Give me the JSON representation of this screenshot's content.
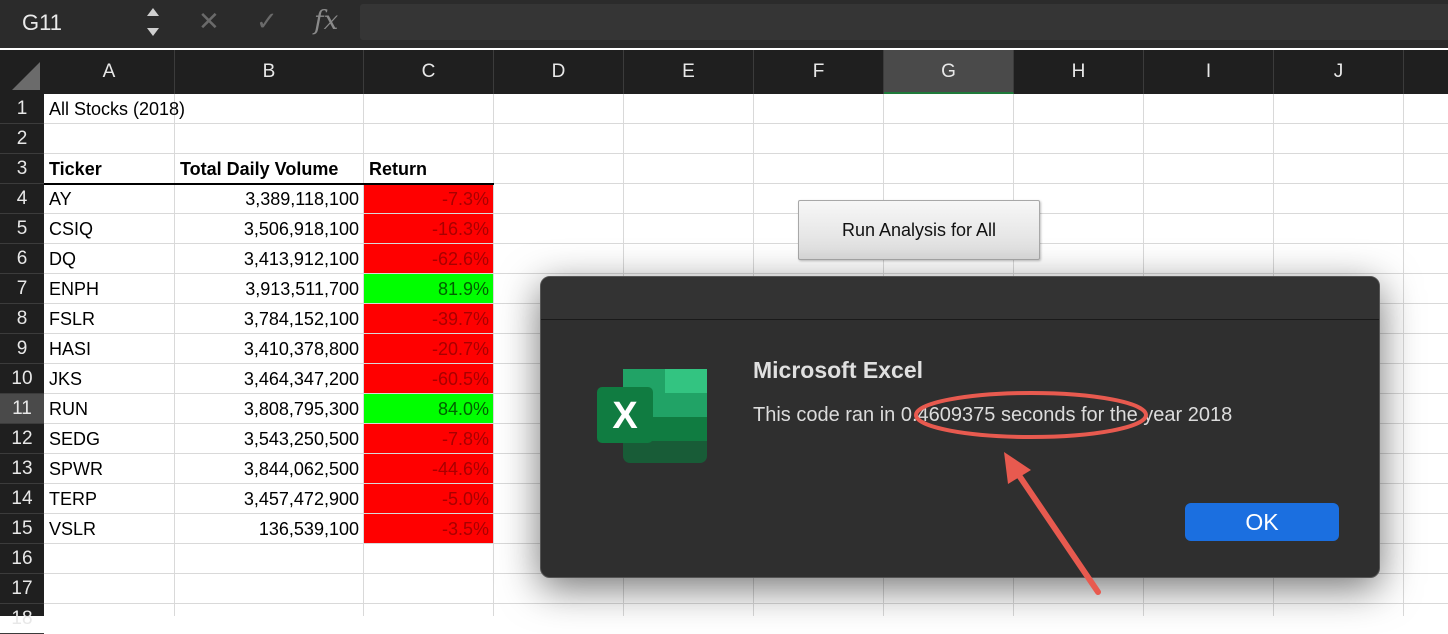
{
  "formula_bar": {
    "cell_ref": "G11",
    "fx_label": "fx",
    "formula": ""
  },
  "columns": [
    "A",
    "B",
    "C",
    "D",
    "E",
    "F",
    "G",
    "H",
    "I",
    "J"
  ],
  "selected_column": "G",
  "rows": [
    "1",
    "2",
    "3",
    "4",
    "5",
    "6",
    "7",
    "8",
    "9",
    "10",
    "11",
    "12",
    "13",
    "14",
    "15",
    "16",
    "17",
    "18"
  ],
  "selected_row": "11",
  "sheet": {
    "title": "All Stocks (2018)",
    "headers": {
      "ticker": "Ticker",
      "volume": "Total Daily Volume",
      "return": "Return"
    },
    "data": [
      {
        "ticker": "AY",
        "volume": "3,389,118,100",
        "return": "-7.3%"
      },
      {
        "ticker": "CSIQ",
        "volume": "3,506,918,100",
        "return": "-16.3%"
      },
      {
        "ticker": "DQ",
        "volume": "3,413,912,100",
        "return": "-62.6%"
      },
      {
        "ticker": "ENPH",
        "volume": "3,913,511,700",
        "return": "81.9%"
      },
      {
        "ticker": "FSLR",
        "volume": "3,784,152,100",
        "return": "-39.7%"
      },
      {
        "ticker": "HASI",
        "volume": "3,410,378,800",
        "return": "-20.7%"
      },
      {
        "ticker": "JKS",
        "volume": "3,464,347,200",
        "return": "-60.5%"
      },
      {
        "ticker": "RUN",
        "volume": "3,808,795,300",
        "return": "84.0%"
      },
      {
        "ticker": "SEDG",
        "volume": "3,543,250,500",
        "return": "-7.8%"
      },
      {
        "ticker": "SPWR",
        "volume": "3,844,062,500",
        "return": "-44.6%"
      },
      {
        "ticker": "TERP",
        "volume": "3,457,472,900",
        "return": "-5.0%"
      },
      {
        "ticker": "VSLR",
        "volume": "136,539,100",
        "return": "-3.5%"
      }
    ]
  },
  "run_button_label": "Run Analysis for All",
  "dialog": {
    "title": "Microsoft Excel",
    "message": "This code ran in 0.4609375 seconds for the year 2018",
    "ok_label": "OK",
    "logo_letter": "X"
  },
  "colors": {
    "negative_fill": "#ff0000",
    "positive_fill": "#00ff00",
    "annotation": "#e85a4f",
    "ok_button": "#1b6fe0"
  }
}
